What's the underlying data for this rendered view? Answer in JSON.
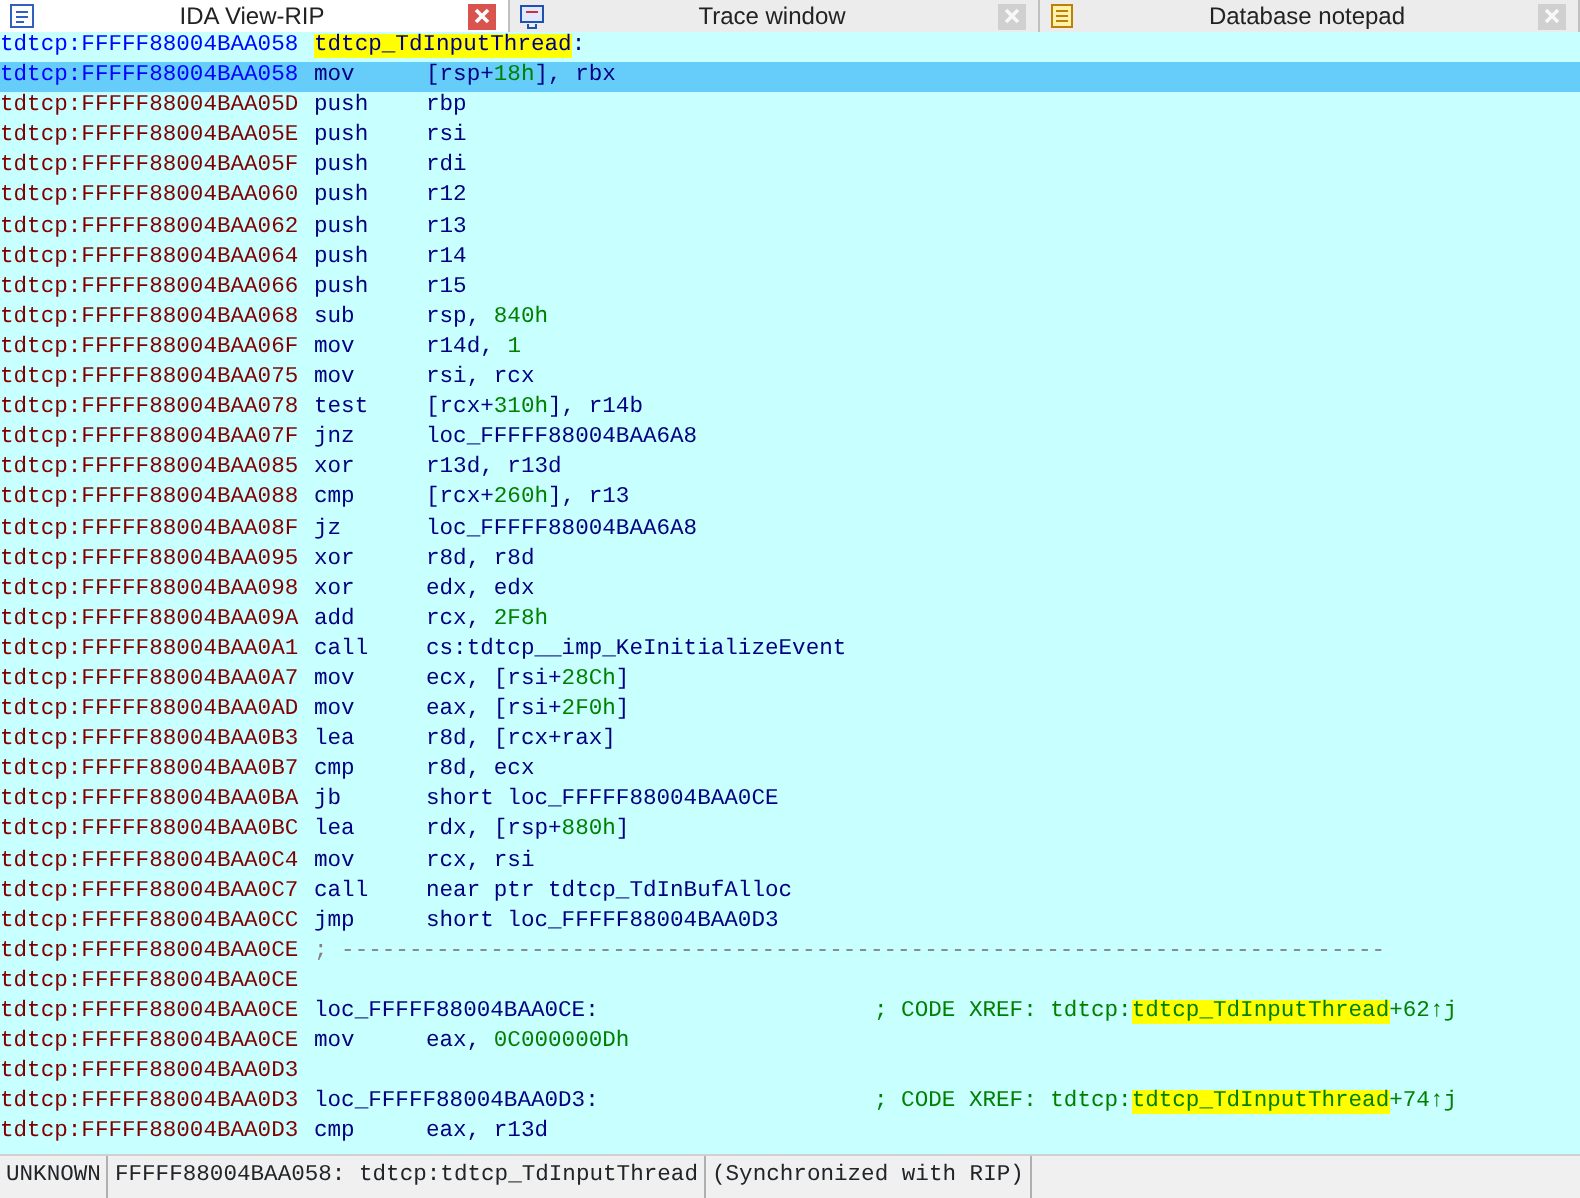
{
  "tabs": [
    {
      "label": "IDA View-RIP",
      "selected": true,
      "kind": "disasm"
    },
    {
      "label": "Trace window",
      "selected": false,
      "kind": "trace"
    },
    {
      "label": "Database notepad",
      "selected": false,
      "kind": "notepad"
    }
  ],
  "lines": [
    {
      "kind": "label",
      "address": "tdtcp:FFFFF88004BAA058",
      "at_ip": true,
      "selected": false,
      "label": [
        {
          "text": "tdtcp_TdInputThread",
          "kind": "highlight"
        },
        {
          "text": ":",
          "kind": "plain"
        }
      ]
    },
    {
      "kind": "insn",
      "address": "tdtcp:FFFFF88004BAA058",
      "at_ip": true,
      "selected": true,
      "mnemonic": "mov",
      "operands": [
        {
          "text": "[rsp+",
          "kind": "plain"
        },
        {
          "text": "18h",
          "kind": "number"
        },
        {
          "text": "], rbx",
          "kind": "plain"
        }
      ]
    },
    {
      "kind": "insn",
      "address": "tdtcp:FFFFF88004BAA05D",
      "at_ip": false,
      "selected": false,
      "mnemonic": "push",
      "operands": [
        {
          "text": "rbp",
          "kind": "plain"
        }
      ]
    },
    {
      "kind": "insn",
      "address": "tdtcp:FFFFF88004BAA05E",
      "at_ip": false,
      "selected": false,
      "mnemonic": "push",
      "operands": [
        {
          "text": "rsi",
          "kind": "plain"
        }
      ]
    },
    {
      "kind": "insn",
      "address": "tdtcp:FFFFF88004BAA05F",
      "at_ip": false,
      "selected": false,
      "mnemonic": "push",
      "operands": [
        {
          "text": "rdi",
          "kind": "plain"
        }
      ]
    },
    {
      "kind": "insn",
      "address": "tdtcp:FFFFF88004BAA060",
      "at_ip": false,
      "selected": false,
      "mnemonic": "push",
      "operands": [
        {
          "text": "r12",
          "kind": "plain"
        }
      ]
    },
    {
      "kind": "insn",
      "address": "tdtcp:FFFFF88004BAA062",
      "at_ip": false,
      "selected": false,
      "mnemonic": "push",
      "operands": [
        {
          "text": "r13",
          "kind": "plain"
        }
      ]
    },
    {
      "kind": "insn",
      "address": "tdtcp:FFFFF88004BAA064",
      "at_ip": false,
      "selected": false,
      "mnemonic": "push",
      "operands": [
        {
          "text": "r14",
          "kind": "plain"
        }
      ]
    },
    {
      "kind": "insn",
      "address": "tdtcp:FFFFF88004BAA066",
      "at_ip": false,
      "selected": false,
      "mnemonic": "push",
      "operands": [
        {
          "text": "r15",
          "kind": "plain"
        }
      ]
    },
    {
      "kind": "insn",
      "address": "tdtcp:FFFFF88004BAA068",
      "at_ip": false,
      "selected": false,
      "mnemonic": "sub",
      "operands": [
        {
          "text": "rsp, ",
          "kind": "plain"
        },
        {
          "text": "840h",
          "kind": "number"
        }
      ]
    },
    {
      "kind": "insn",
      "address": "tdtcp:FFFFF88004BAA06F",
      "at_ip": false,
      "selected": false,
      "mnemonic": "mov",
      "operands": [
        {
          "text": "r14d, ",
          "kind": "plain"
        },
        {
          "text": "1",
          "kind": "number"
        }
      ]
    },
    {
      "kind": "insn",
      "address": "tdtcp:FFFFF88004BAA075",
      "at_ip": false,
      "selected": false,
      "mnemonic": "mov",
      "operands": [
        {
          "text": "rsi, rcx",
          "kind": "plain"
        }
      ]
    },
    {
      "kind": "insn",
      "address": "tdtcp:FFFFF88004BAA078",
      "at_ip": false,
      "selected": false,
      "mnemonic": "test",
      "operands": [
        {
          "text": "[rcx+",
          "kind": "plain"
        },
        {
          "text": "310h",
          "kind": "number"
        },
        {
          "text": "], r14b",
          "kind": "plain"
        }
      ]
    },
    {
      "kind": "insn",
      "address": "tdtcp:FFFFF88004BAA07F",
      "at_ip": false,
      "selected": false,
      "mnemonic": "jnz",
      "operands": [
        {
          "text": "loc_FFFFF88004BAA6A8",
          "kind": "plain"
        }
      ]
    },
    {
      "kind": "insn",
      "address": "tdtcp:FFFFF88004BAA085",
      "at_ip": false,
      "selected": false,
      "mnemonic": "xor",
      "operands": [
        {
          "text": "r13d, r13d",
          "kind": "plain"
        }
      ]
    },
    {
      "kind": "insn",
      "address": "tdtcp:FFFFF88004BAA088",
      "at_ip": false,
      "selected": false,
      "mnemonic": "cmp",
      "operands": [
        {
          "text": "[rcx+",
          "kind": "plain"
        },
        {
          "text": "260h",
          "kind": "number"
        },
        {
          "text": "], r13",
          "kind": "plain"
        }
      ]
    },
    {
      "kind": "insn",
      "address": "tdtcp:FFFFF88004BAA08F",
      "at_ip": false,
      "selected": false,
      "mnemonic": "jz",
      "operands": [
        {
          "text": "loc_FFFFF88004BAA6A8",
          "kind": "plain"
        }
      ]
    },
    {
      "kind": "insn",
      "address": "tdtcp:FFFFF88004BAA095",
      "at_ip": false,
      "selected": false,
      "mnemonic": "xor",
      "operands": [
        {
          "text": "r8d, r8d",
          "kind": "plain"
        }
      ]
    },
    {
      "kind": "insn",
      "address": "tdtcp:FFFFF88004BAA098",
      "at_ip": false,
      "selected": false,
      "mnemonic": "xor",
      "operands": [
        {
          "text": "edx, edx",
          "kind": "plain"
        }
      ]
    },
    {
      "kind": "insn",
      "address": "tdtcp:FFFFF88004BAA09A",
      "at_ip": false,
      "selected": false,
      "mnemonic": "add",
      "operands": [
        {
          "text": "rcx, ",
          "kind": "plain"
        },
        {
          "text": "2F8h",
          "kind": "number"
        }
      ]
    },
    {
      "kind": "insn",
      "address": "tdtcp:FFFFF88004BAA0A1",
      "at_ip": false,
      "selected": false,
      "mnemonic": "call",
      "operands": [
        {
          "text": "cs:tdtcp__imp_KeInitializeEvent",
          "kind": "plain"
        }
      ]
    },
    {
      "kind": "insn",
      "address": "tdtcp:FFFFF88004BAA0A7",
      "at_ip": false,
      "selected": false,
      "mnemonic": "mov",
      "operands": [
        {
          "text": "ecx, [rsi+",
          "kind": "plain"
        },
        {
          "text": "28Ch",
          "kind": "number"
        },
        {
          "text": "]",
          "kind": "plain"
        }
      ]
    },
    {
      "kind": "insn",
      "address": "tdtcp:FFFFF88004BAA0AD",
      "at_ip": false,
      "selected": false,
      "mnemonic": "mov",
      "operands": [
        {
          "text": "eax, [rsi+",
          "kind": "plain"
        },
        {
          "text": "2F0h",
          "kind": "number"
        },
        {
          "text": "]",
          "kind": "plain"
        }
      ]
    },
    {
      "kind": "insn",
      "address": "tdtcp:FFFFF88004BAA0B3",
      "at_ip": false,
      "selected": false,
      "mnemonic": "lea",
      "operands": [
        {
          "text": "r8d, [rcx+rax]",
          "kind": "plain"
        }
      ]
    },
    {
      "kind": "insn",
      "address": "tdtcp:FFFFF88004BAA0B7",
      "at_ip": false,
      "selected": false,
      "mnemonic": "cmp",
      "operands": [
        {
          "text": "r8d, ecx",
          "kind": "plain"
        }
      ]
    },
    {
      "kind": "insn",
      "address": "tdtcp:FFFFF88004BAA0BA",
      "at_ip": false,
      "selected": false,
      "mnemonic": "jb",
      "operands": [
        {
          "text": "short loc_FFFFF88004BAA0CE",
          "kind": "plain"
        }
      ]
    },
    {
      "kind": "insn",
      "address": "tdtcp:FFFFF88004BAA0BC",
      "at_ip": false,
      "selected": false,
      "mnemonic": "lea",
      "operands": [
        {
          "text": "rdx, [rsp+",
          "kind": "plain"
        },
        {
          "text": "880h",
          "kind": "number"
        },
        {
          "text": "]",
          "kind": "plain"
        }
      ]
    },
    {
      "kind": "insn",
      "address": "tdtcp:FFFFF88004BAA0C4",
      "at_ip": false,
      "selected": false,
      "mnemonic": "mov",
      "operands": [
        {
          "text": "rcx, rsi",
          "kind": "plain"
        }
      ]
    },
    {
      "kind": "insn",
      "address": "tdtcp:FFFFF88004BAA0C7",
      "at_ip": false,
      "selected": false,
      "mnemonic": "call",
      "operands": [
        {
          "text": "near ptr tdtcp_TdInBufAlloc",
          "kind": "plain"
        }
      ]
    },
    {
      "kind": "insn",
      "address": "tdtcp:FFFFF88004BAA0CC",
      "at_ip": false,
      "selected": false,
      "mnemonic": "jmp",
      "operands": [
        {
          "text": "short loc_FFFFF88004BAA0D3",
          "kind": "plain"
        }
      ]
    },
    {
      "kind": "separator",
      "address": "tdtcp:FFFFF88004BAA0CE",
      "at_ip": false,
      "selected": false,
      "text": "; -----------------------------------------------------------------------------"
    },
    {
      "kind": "blank",
      "address": "tdtcp:FFFFF88004BAA0CE",
      "at_ip": false,
      "selected": false
    },
    {
      "kind": "label",
      "address": "tdtcp:FFFFF88004BAA0CE",
      "at_ip": false,
      "selected": false,
      "label": [
        {
          "text": "loc_FFFFF88004BAA0CE:",
          "kind": "plain"
        }
      ],
      "comment": [
        {
          "text": "; CODE XREF: tdtcp:",
          "kind": "plain"
        },
        {
          "text": "tdtcp_TdInputThread",
          "kind": "highlight"
        },
        {
          "text": "+62↑j",
          "kind": "plain"
        }
      ]
    },
    {
      "kind": "insn",
      "address": "tdtcp:FFFFF88004BAA0CE",
      "at_ip": false,
      "selected": false,
      "mnemonic": "mov",
      "operands": [
        {
          "text": "eax, ",
          "kind": "plain"
        },
        {
          "text": "0C000000Dh",
          "kind": "number"
        }
      ]
    },
    {
      "kind": "blank",
      "address": "tdtcp:FFFFF88004BAA0D3",
      "at_ip": false,
      "selected": false
    },
    {
      "kind": "label",
      "address": "tdtcp:FFFFF88004BAA0D3",
      "at_ip": false,
      "selected": false,
      "label": [
        {
          "text": "loc_FFFFF88004BAA0D3:",
          "kind": "plain"
        }
      ],
      "comment": [
        {
          "text": "; CODE XREF: tdtcp:",
          "kind": "plain"
        },
        {
          "text": "tdtcp_TdInputThread",
          "kind": "highlight"
        },
        {
          "text": "+74↑j",
          "kind": "plain"
        }
      ]
    },
    {
      "kind": "insn",
      "address": "tdtcp:FFFFF88004BAA0D3",
      "at_ip": false,
      "selected": false,
      "mnemonic": "cmp",
      "operands": [
        {
          "text": "eax, r13d",
          "kind": "plain"
        }
      ]
    }
  ],
  "status_bar": [
    "UNKNOWN",
    "FFFFF88004BAA058: tdtcp:tdtcp_TdInputThread",
    "(Synchronized with RIP)"
  ]
}
